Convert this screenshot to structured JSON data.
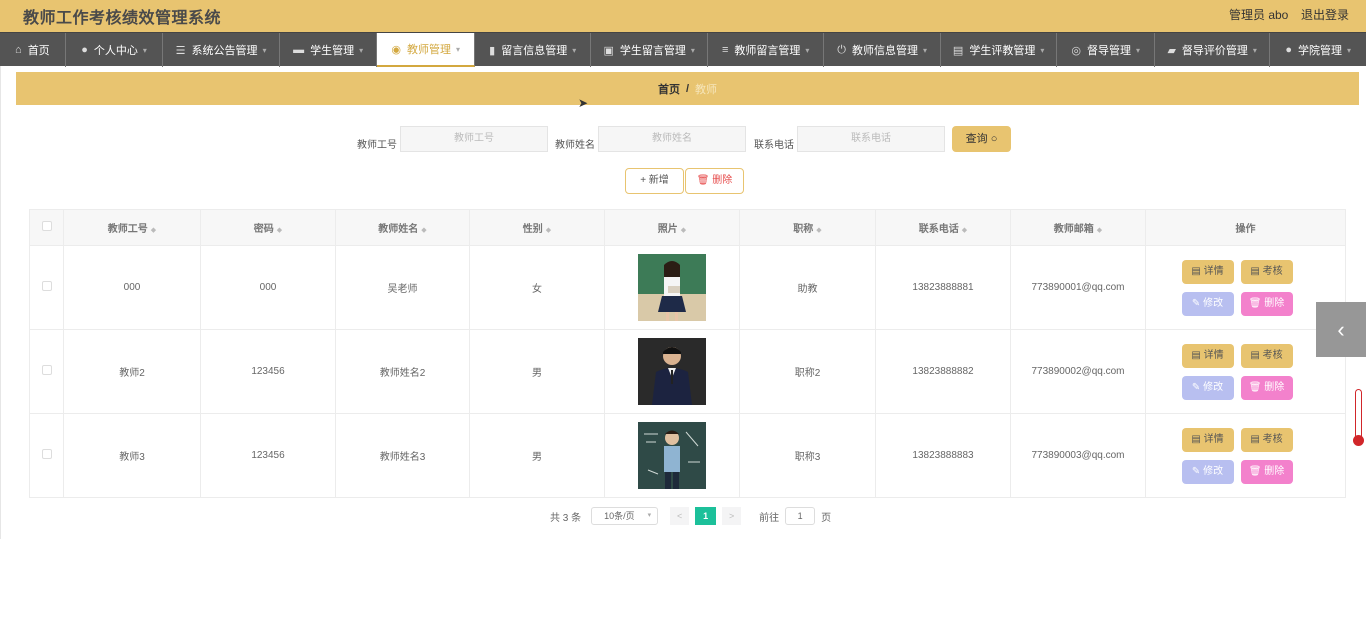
{
  "header": {
    "title": "教师工作考核绩效管理系统",
    "admin_label": "管理员 abo",
    "logout_label": "退出登录"
  },
  "nav": [
    {
      "label": "首页",
      "icon": "home-icon"
    },
    {
      "label": "个人中心",
      "icon": "user-icon"
    },
    {
      "label": "系统公告管理",
      "icon": "sliders-icon"
    },
    {
      "label": "学生管理",
      "icon": "chat-icon"
    },
    {
      "label": "教师管理",
      "icon": "location-icon",
      "active": true
    },
    {
      "label": "留言信息管理",
      "icon": "bar-chart-icon"
    },
    {
      "label": "学生留言管理",
      "icon": "document-icon"
    },
    {
      "label": "教师留言管理",
      "icon": "list-icon"
    },
    {
      "label": "教师信息管理",
      "icon": "power-icon"
    },
    {
      "label": "学生评教管理",
      "icon": "printer-icon"
    },
    {
      "label": "督导管理",
      "icon": "globe-icon"
    },
    {
      "label": "督导评价管理",
      "icon": "wallet-icon"
    },
    {
      "label": "学院管理",
      "icon": "user-icon"
    }
  ],
  "breadcrumb": {
    "home": "首页",
    "separator": "/",
    "current": "教师"
  },
  "search": {
    "fields": [
      {
        "label": "教师工号",
        "placeholder": "教师工号"
      },
      {
        "label": "教师姓名",
        "placeholder": "教师姓名"
      },
      {
        "label": "联系电话",
        "placeholder": "联系电话"
      }
    ],
    "query_label": "查询 ○"
  },
  "actions": {
    "add_label": "+ 新增",
    "delete_label": "删除"
  },
  "table": {
    "columns": [
      "教师工号",
      "密码",
      "教师姓名",
      "性别",
      "照片",
      "职称",
      "联系电话",
      "教师邮箱",
      "操作"
    ],
    "rows": [
      {
        "id": "000",
        "password": "000",
        "name": "吴老师",
        "gender": "女",
        "title": "助教",
        "phone": "13823888881",
        "email": "773890001@qq.com"
      },
      {
        "id": "教师2",
        "password": "123456",
        "name": "教师姓名2",
        "gender": "男",
        "title": "职称2",
        "phone": "13823888882",
        "email": "773890002@qq.com"
      },
      {
        "id": "教师3",
        "password": "123456",
        "name": "教师姓名3",
        "gender": "男",
        "title": "职称3",
        "phone": "13823888883",
        "email": "773890003@qq.com"
      }
    ],
    "op_labels": {
      "detail": "详情",
      "audit": "考核",
      "edit": "修改",
      "delete": "删除"
    }
  },
  "pagination": {
    "total": "共 3 条",
    "page_size": "10条/页",
    "prev": "<",
    "current_page": "1",
    "next": ">",
    "goto_prefix": "前往",
    "goto_value": "1",
    "goto_suffix": "页"
  },
  "colors": {
    "accent": "#e8c470",
    "nav_bg": "#545454",
    "delete": "#f381cc",
    "edit": "#b8bff0",
    "page_active": "#1cc09a"
  }
}
